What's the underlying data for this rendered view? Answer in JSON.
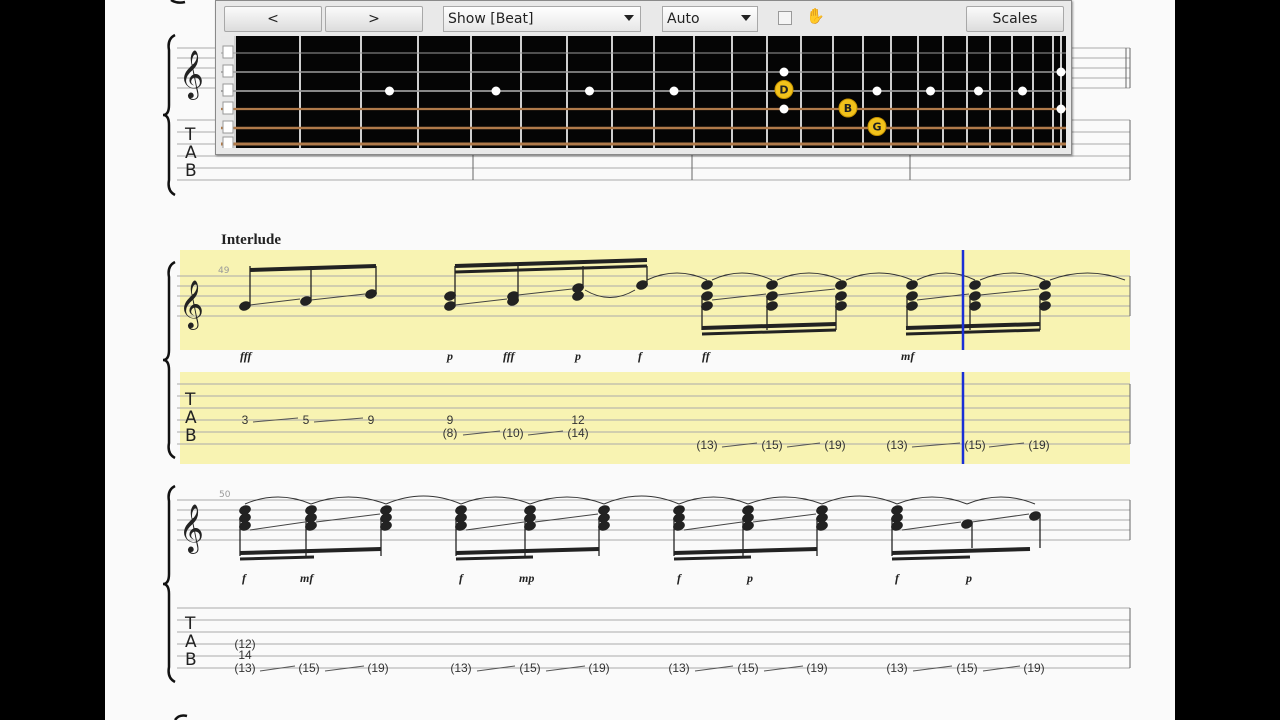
{
  "toolbar": {
    "prev_label": "<",
    "next_label": ">",
    "show_select": "Show [Beat]",
    "mode_select": "Auto",
    "scales_label": "Scales",
    "icons": [
      "checkbox",
      "hand-icon"
    ]
  },
  "fretboard": {
    "frets": 24,
    "strings": 6,
    "inlays": [
      3,
      5,
      7,
      9,
      12,
      15,
      17,
      19,
      21,
      24
    ],
    "notes": [
      {
        "label": "D",
        "string": 3,
        "fret": 12
      },
      {
        "label": "B",
        "string": 4,
        "fret": 14
      },
      {
        "label": "G",
        "string": 5,
        "fret": 15
      }
    ],
    "accent_color": "#f2c21b"
  },
  "systems": [
    {
      "section": "Interlude",
      "measure": "49",
      "dynamics": [
        "fff",
        "p",
        "fff",
        "p",
        "f",
        "ff",
        "mf"
      ],
      "tab": {
        "beats": [
          {
            "frets": [
              "3"
            ]
          },
          {
            "frets": [
              "5"
            ]
          },
          {
            "frets": [
              "9"
            ]
          },
          {
            "frets": [
              "9",
              "(8)"
            ]
          },
          {
            "frets": [
              "(10)"
            ]
          },
          {
            "frets": [
              "12",
              "(14)"
            ]
          },
          {
            "frets": [
              "(13)"
            ]
          },
          {
            "frets": [
              "(15)"
            ]
          },
          {
            "frets": [
              "(19)"
            ]
          },
          {
            "frets": [
              "(13)"
            ]
          },
          {
            "frets": [
              "(15)"
            ]
          },
          {
            "frets": [
              "(19)"
            ]
          }
        ]
      }
    },
    {
      "measure": "50",
      "dynamics": [
        "f",
        "mf",
        "f",
        "mp",
        "f",
        "p",
        "f",
        "p"
      ],
      "tab": {
        "chord": [
          "(12)",
          "14",
          "(13)"
        ],
        "beats": [
          "(15)",
          "(19)",
          "(13)",
          "(15)",
          "(19)",
          "(13)",
          "(15)",
          "(19)",
          "(13)",
          "(15)",
          "(19)"
        ]
      }
    }
  ],
  "highlight_color": "#f8f3b2",
  "cursor_color": "#1a2fd6"
}
